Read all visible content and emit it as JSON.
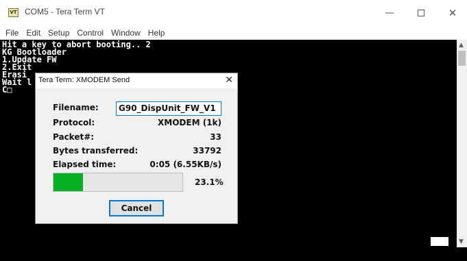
{
  "window": {
    "icon_text": "VT",
    "title": "COM5 - Tera Term VT",
    "min_glyph": "—",
    "close_glyph": "✕"
  },
  "menu": [
    "File",
    "Edit",
    "Setup",
    "Control",
    "Window",
    "Help"
  ],
  "terminal": {
    "lines": [
      "Hit a key to abort booting.. 2",
      "KG Bootloader",
      "1.Update FW",
      "2.Exit",
      "Erasi",
      "Wait l",
      "C□"
    ]
  },
  "scrollbar": {
    "up_glyph": "▲",
    "down_glyph": "▼"
  },
  "dialog": {
    "title": "Tera Term: XMODEM Send",
    "close_glyph": "✕",
    "filename_label": "Filename:",
    "filename_value": "G90_DispUnit_FW_V1",
    "protocol_label": "Protocol:",
    "protocol_value": "XMODEM (1k)",
    "packet_label": "Packet#:",
    "packet_value": "33",
    "bytes_label": "Bytes transferred:",
    "bytes_value": "33792",
    "elapsed_label": "Elapsed time:",
    "elapsed_value": "0:05 (6.55KB/s)",
    "progress_percent": 23.1,
    "progress_text": "23.1%",
    "cancel_label": "Cancel"
  },
  "colors": {
    "terminal_bg": "#000000",
    "terminal_fg": "#ffffff",
    "progress_fill": "#06b025",
    "focus_border": "#0078d7"
  }
}
